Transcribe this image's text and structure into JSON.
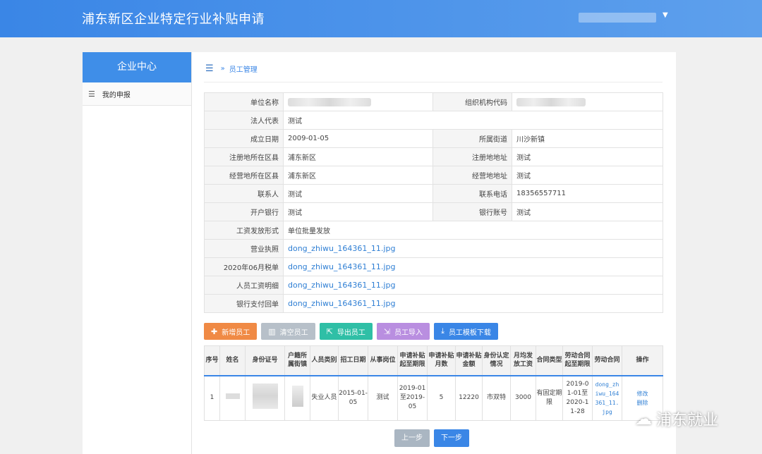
{
  "header": {
    "title": "浦东新区企业特定行业补贴申请"
  },
  "sidebar": {
    "title": "企业中心",
    "items": [
      {
        "label": "我的申报"
      }
    ]
  },
  "breadcrumb": {
    "separator": "»",
    "current": "员工管理"
  },
  "info": {
    "rows": [
      {
        "l1": "单位名称",
        "v1": "",
        "l2": "组织机构代码",
        "v2": ""
      },
      {
        "l1": "法人代表",
        "v1": "测试"
      },
      {
        "l1": "成立日期",
        "v1": "2009-01-05",
        "l2": "所属街道",
        "v2": "川沙新镇"
      },
      {
        "l1": "注册地所在区县",
        "v1": "浦东新区",
        "l2": "注册地地址",
        "v2": "测试"
      },
      {
        "l1": "经营地所在区县",
        "v1": "浦东新区",
        "l2": "经营地地址",
        "v2": "测试"
      },
      {
        "l1": "联系人",
        "v1": "测试",
        "l2": "联系电话",
        "v2": "18356557711"
      },
      {
        "l1": "开户银行",
        "v1": "测试",
        "l2": "银行账号",
        "v2": "测试"
      },
      {
        "l1": "工资发放形式",
        "v1": "单位批量发放"
      },
      {
        "l1": "营业执照",
        "v1": "dong_zhiwu_164361_11.jpg"
      },
      {
        "l1": "2020年06月税单",
        "v1": "dong_zhiwu_164361_11.jpg"
      },
      {
        "l1": "人员工资明细",
        "v1": "dong_zhiwu_164361_11.jpg"
      },
      {
        "l1": "银行支付回单",
        "v1": "dong_zhiwu_164361_11.jpg"
      }
    ]
  },
  "toolbar": {
    "add": "新增员工",
    "clear": "清空员工",
    "export": "导出员工",
    "import": "员工导入",
    "template": "员工模板下载"
  },
  "colors": {
    "add": "#f08a45",
    "clear": "#b7c0c9",
    "export": "#2fbfa6",
    "import": "#b98ee0",
    "template": "#3a86e6"
  },
  "employees": {
    "headers": [
      "序号",
      "姓名",
      "身份证号",
      "户籍所属街镇",
      "人员类别",
      "招工日期",
      "从事岗位",
      "申请补贴起至期限",
      "申请补贴月数",
      "申请补贴金额",
      "身份认定情况",
      "月均发放工资",
      "合同类型",
      "劳动合同起至期限",
      "劳动合同",
      "操作"
    ],
    "rows": [
      {
        "no": "1",
        "category": "失业人员",
        "hire_date": "2015-01-05",
        "post": "测试",
        "subsidy_period": "2019-01至2019-05",
        "months": "5",
        "amount": "12220",
        "identity": "市双特",
        "wage": "3000",
        "contract_type": "有固定期限",
        "contract_period": "2019-01-01至2020-11-28",
        "contract_file": "dong_zhiwu_164361_11.jpg",
        "op_edit": "修改",
        "op_delete": "删除"
      }
    ]
  },
  "pager": {
    "prev": "上一步",
    "next": "下一步"
  },
  "watermark": {
    "text": "浦东就业"
  }
}
